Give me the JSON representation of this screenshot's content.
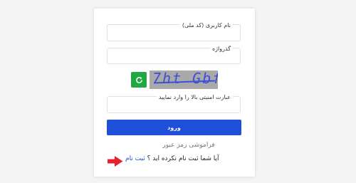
{
  "form": {
    "username_label": "نام کاربری (کد ملی)",
    "username_value": "",
    "password_label": "گذرواژه",
    "password_value": "",
    "captcha_text": "7ht Gbf",
    "captcha_answer_label": "عبارت امنیتی بالا را وارد نمایید",
    "captcha_answer_value": "",
    "login_label": "ورود",
    "forgot_label": "فراموشی رمز عبور",
    "register_question": "آیا شما ثبت نام نکرده اید ؟ ",
    "register_link": "ثبت نام"
  },
  "icons": {
    "refresh": "refresh-icon",
    "arrow": "right-arrow-icon"
  },
  "colors": {
    "primary": "#1d4fd8",
    "refresh": "#22a843",
    "arrow": "#e8222a",
    "captcha_bg": "#a9a9a9"
  }
}
